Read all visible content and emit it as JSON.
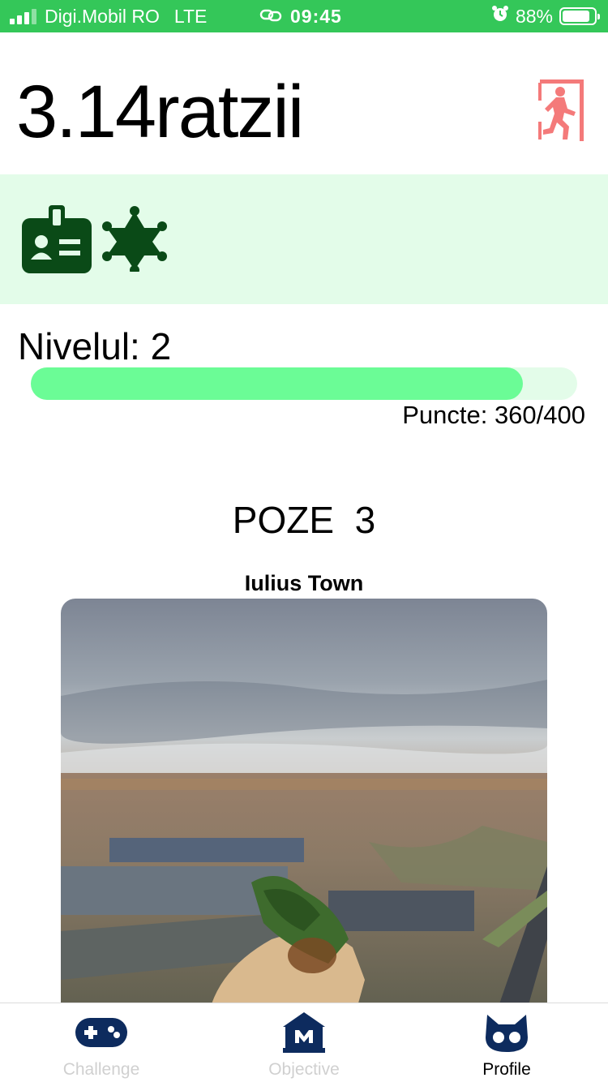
{
  "status_bar": {
    "carrier": "Digi.Mobil RO",
    "network": "LTE",
    "time": "09:45",
    "battery_percent": "88%",
    "battery_level": 0.88,
    "signal_bars": 3,
    "background_color": "#34c759",
    "icons": [
      "signal-icon",
      "link-icon",
      "alarm-icon",
      "battery-icon"
    ]
  },
  "profile": {
    "username": "3.14ratzii",
    "exit_icon": "exit-door-icon",
    "exit_icon_color": "#f47a7a"
  },
  "badges": {
    "background_color": "#e3fce9",
    "icon_color": "#0a4a17",
    "items": [
      {
        "icon": "id-badge-icon"
      },
      {
        "icon": "sheriff-star-icon"
      }
    ]
  },
  "level": {
    "label": "Nivelul: 2",
    "points_label": "Puncte: 360/400",
    "points": 360,
    "points_max": 400,
    "progress_color": "#6bfc96"
  },
  "photos": {
    "title": "POZE  3",
    "items": [
      {
        "caption": "Iulius Town"
      }
    ]
  },
  "tab_bar": {
    "icon_color": "#0d2b5e",
    "tabs": [
      {
        "label": "Challenge",
        "icon": "gamepad-icon",
        "active": false
      },
      {
        "label": "Objective",
        "icon": "museum-icon",
        "active": false
      },
      {
        "label": "Profile",
        "icon": "cat-face-icon",
        "active": true
      }
    ]
  }
}
